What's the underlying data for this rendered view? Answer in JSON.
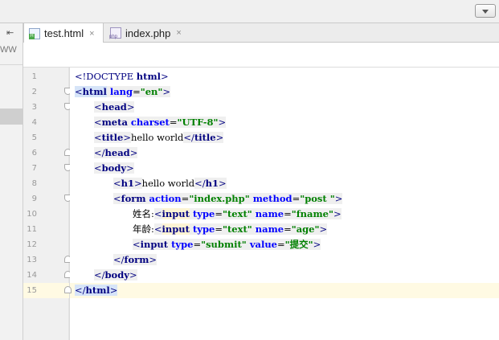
{
  "tabs": [
    {
      "label": "test.html",
      "badge": "H",
      "active": true,
      "close": "×"
    },
    {
      "label": "index.php",
      "badge": "php",
      "active": false,
      "close": "×"
    }
  ],
  "left_strip": {
    "label": "WW",
    "collapse_glyph": "⇤"
  },
  "line_numbers": [
    "1",
    "2",
    "3",
    "4",
    "5",
    "6",
    "7",
    "8",
    "9",
    "10",
    "11",
    "12",
    "13",
    "14",
    "15"
  ],
  "code": {
    "l1": {
      "doctype_open": "<!DOCTYPE ",
      "doctype_tag": "html",
      "close": ">"
    },
    "l2": {
      "open": "<",
      "tag": "html",
      "attr": " lang",
      "eq": "=",
      "val": "\"en\"",
      "close": ">"
    },
    "l3": {
      "open": "<",
      "tag": "head",
      "close": ">"
    },
    "l4": {
      "open": "<",
      "tag": "meta",
      "attr": " charset",
      "eq": "=",
      "val": "\"UTF-8\"",
      "close": ">"
    },
    "l5": {
      "open": "<",
      "tag": "title",
      "close": ">",
      "text": "hello world",
      "end_open": "</",
      "end_tag": "title",
      "end_close": ">"
    },
    "l6": {
      "open": "</",
      "tag": "head",
      "close": ">"
    },
    "l7": {
      "open": "<",
      "tag": "body",
      "close": ">"
    },
    "l8": {
      "open": "<",
      "tag": "h1",
      "close": ">",
      "text": "hello world",
      "end_open": "</",
      "end_tag": "h1",
      "end_close": ">"
    },
    "l9": {
      "open": "<",
      "tag": "form",
      "attr1": " action",
      "eq1": "=",
      "val1": "\"index.php\"",
      "attr2": " method",
      "eq2": "=",
      "val2": "\"post \"",
      "close": ">"
    },
    "l10": {
      "label": "姓名:",
      "open": "<",
      "tag": "input",
      "attr1": " type",
      "eq1": "=",
      "val1": "\"text\"",
      "attr2": " name",
      "eq2": "=",
      "val2": "\"fname\"",
      "close": ">"
    },
    "l11": {
      "label": "年龄:",
      "open": "<",
      "tag": "input",
      "attr1": " type",
      "eq1": "=",
      "val1": "\"text\"",
      "attr2": " name",
      "eq2": "=",
      "val2": "\"age\"",
      "close": ">"
    },
    "l12": {
      "open": "<",
      "tag": "input",
      "attr1": " type",
      "eq1": "=",
      "val1": "\"submit\"",
      "attr2": " value",
      "eq2": "=",
      "val2": "\"提交\"",
      "close": ">"
    },
    "l13": {
      "open": "</",
      "tag": "form",
      "close": ">"
    },
    "l14": {
      "open": "</",
      "tag": "body",
      "close": ">"
    },
    "l15": {
      "open": "</",
      "tag": "html",
      "close": ">"
    }
  },
  "colors": {
    "tag": "#000080",
    "attribute": "#0000ff",
    "string": "#008000",
    "current_line": "#fffae3",
    "matched_tag_highlight": "#d6e4f8"
  }
}
